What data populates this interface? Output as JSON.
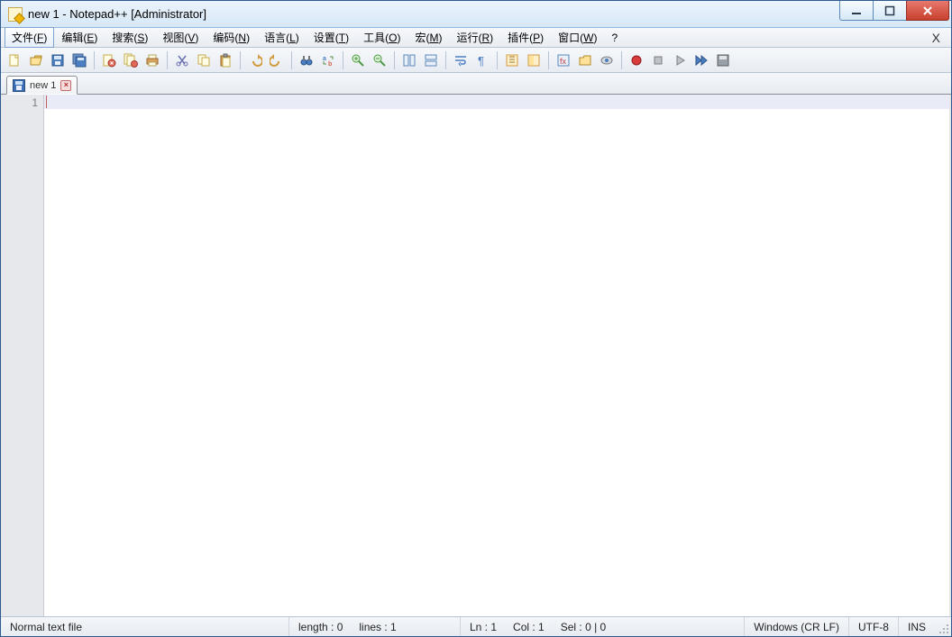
{
  "window": {
    "title": "new 1 - Notepad++  [Administrator]"
  },
  "menus": {
    "file": {
      "label": "文件(",
      "key": "F",
      "suffix": ")"
    },
    "edit": {
      "label": "编辑(",
      "key": "E",
      "suffix": ")"
    },
    "search": {
      "label": "搜索(",
      "key": "S",
      "suffix": ")"
    },
    "view": {
      "label": "视图(",
      "key": "V",
      "suffix": ")"
    },
    "encoding": {
      "label": "编码(",
      "key": "N",
      "suffix": ")"
    },
    "language": {
      "label": "语言(",
      "key": "L",
      "suffix": ")"
    },
    "settings": {
      "label": "设置(",
      "key": "T",
      "suffix": ")"
    },
    "tools": {
      "label": "工具(",
      "key": "O",
      "suffix": ")"
    },
    "macro": {
      "label": "宏(",
      "key": "M",
      "suffix": ")"
    },
    "run": {
      "label": "运行(",
      "key": "R",
      "suffix": ")"
    },
    "plugins": {
      "label": "插件(",
      "key": "P",
      "suffix": ")"
    },
    "windowm": {
      "label": "窗口(",
      "key": "W",
      "suffix": ")"
    },
    "help": {
      "label": "?"
    }
  },
  "tabs": [
    {
      "label": "new 1"
    }
  ],
  "editor": {
    "line_numbers": [
      "1"
    ]
  },
  "status": {
    "filetype": "Normal text file",
    "length_label": "length : 0",
    "lines_label": "lines : 1",
    "ln_label": "Ln : 1",
    "col_label": "Col : 1",
    "sel_label": "Sel : 0 | 0",
    "eol": "Windows (CR LF)",
    "encoding": "UTF-8",
    "insert_mode": "INS"
  }
}
